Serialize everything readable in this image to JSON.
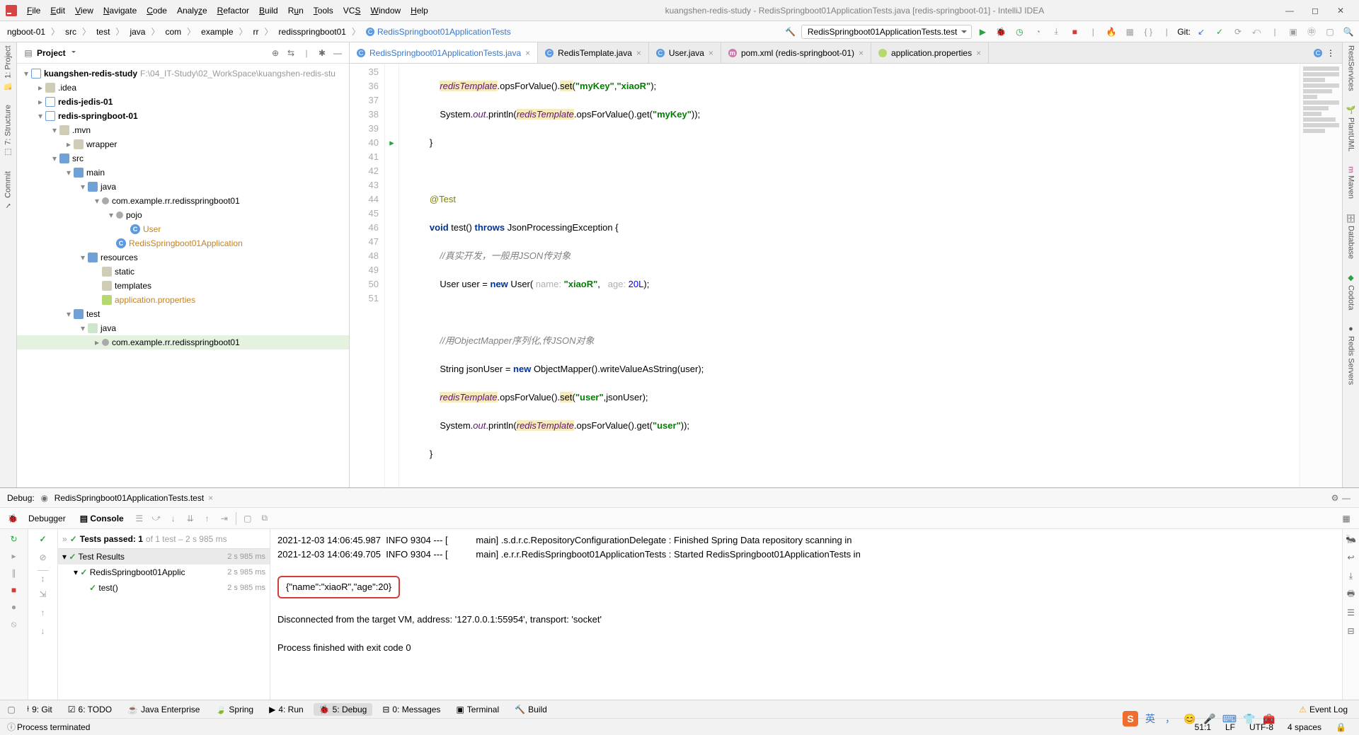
{
  "window_title": "kuangshen-redis-study - RedisSpringboot01ApplicationTests.java [redis-springboot-01] - IntelliJ IDEA",
  "menubar": [
    "File",
    "Edit",
    "View",
    "Navigate",
    "Code",
    "Analyze",
    "Refactor",
    "Build",
    "Run",
    "Tools",
    "VCS",
    "Window",
    "Help"
  ],
  "breadcrumb": [
    "ngboot-01",
    "src",
    "test",
    "java",
    "com",
    "example",
    "rr",
    "redisspringboot01",
    "RedisSpringboot01ApplicationTests"
  ],
  "run_target": "RedisSpringboot01ApplicationTests.test",
  "git_label": "Git:",
  "left_tabs": [
    "1: Project",
    "7: Structure",
    "Commit"
  ],
  "right_tabs": [
    "RestServices",
    "PlantUML",
    "Maven",
    "Database",
    "Codota",
    "Redis Servers"
  ],
  "sidebar": {
    "title": "Project",
    "root": "kuangshen-redis-study",
    "root_path": "F:\\04_IT-Study\\02_WorkSpace\\kuangshen-redis-stu",
    "nodes": [
      ".idea",
      "redis-jedis-01",
      "redis-springboot-01",
      ".mvn",
      "wrapper",
      "src",
      "main",
      "java",
      "com.example.rr.redisspringboot01",
      "pojo",
      "User",
      "RedisSpringboot01Application",
      "resources",
      "static",
      "templates",
      "application.properties",
      "test",
      "java",
      "com.example.rr.redisspringboot01"
    ]
  },
  "tabs": [
    {
      "label": "RedisSpringboot01ApplicationTests.java",
      "icon": "C",
      "active": true
    },
    {
      "label": "RedisTemplate.java",
      "icon": "C"
    },
    {
      "label": "User.java",
      "icon": "C"
    },
    {
      "label": "pom.xml (redis-springboot-01)",
      "icon": "m"
    },
    {
      "label": "application.properties",
      "icon": "p"
    }
  ],
  "code_start_line": 35,
  "code": {
    "l35": {
      "pre": "            ",
      "warn": "redisTemplate",
      "mid": ".opsForValue().",
      "set": "set",
      "s1": "\"myKey\"",
      "s2": "\"xiaoR\"",
      "tail": ");"
    },
    "l36": {
      "pre": "            System.",
      "out": "out",
      "mid": ".println(",
      "warn": "redisTemplate",
      "tail1": ".opsForValue().get(",
      "s": "\"myKey\"",
      "tail2": "));"
    },
    "brace": "        }",
    "ann": "@Test",
    "sig": {
      "v": "void",
      "name": " test() ",
      "th": "throws",
      "ex": " JsonProcessingException {"
    },
    "c1": "//真实开发，一般用JSON传对象",
    "l42": {
      "pre": "            User user = ",
      "new": "new",
      "mid": " User( ",
      "h1": "name: ",
      "s1": "\"xiaoR\"",
      "sep": ",   ",
      "h2": "age: ",
      "n": "20L",
      "tail": ");"
    },
    "c2": "//用ObjectMapper序列化,传JSON对象",
    "l45": {
      "pre": "            String jsonUser = ",
      "new": "new",
      "tail": " ObjectMapper().writeValueAsString(user);"
    },
    "l46": {
      "pre": "            ",
      "warn": "redisTemplate",
      "mid": ".opsForValue().",
      "set": "set",
      "s": "\"user\"",
      "tail": ",jsonUser);"
    },
    "l47": {
      "pre": "            System.",
      "out": "out",
      "mid": ".println(",
      "warn": "redisTemplate",
      "t1": ".opsForValue().get(",
      "s": "\"user\"",
      "t2": "));"
    },
    "brace2": "        }",
    "cbrace": "    }"
  },
  "debug": {
    "label": "Debug:",
    "config": "RedisSpringboot01ApplicationTests.test",
    "tab_debugger": "Debugger",
    "tab_console": "Console",
    "tests_passed": "Tests passed: 1",
    "tests_total": " of 1 test – 2 s 985 ms",
    "test_results": "Test Results",
    "test1": "RedisSpringboot01Applic",
    "test2": "test()",
    "dur": "2 s 985 ms",
    "log1": "2021-12-03 14:06:45.987  INFO 9304 --- [           main] .s.d.r.c.RepositoryConfigurationDelegate : Finished Spring Data repository scanning in ",
    "log2": "2021-12-03 14:06:49.705  INFO 9304 --- [           main] .e.r.r.RedisSpringboot01ApplicationTests : Started RedisSpringboot01ApplicationTests in ",
    "json_out": "{\"name\":\"xiaoR\",\"age\":20}",
    "log3": "Disconnected from the target VM, address: '127.0.0.1:55954', transport: 'socket'",
    "log4": "Process finished with exit code 0"
  },
  "bottom_tabs": [
    "9: Git",
    "6: TODO",
    "Java Enterprise",
    "Spring",
    "4: Run",
    "5: Debug",
    "0: Messages",
    "Terminal",
    "Build"
  ],
  "event_log": "Event Log",
  "status": {
    "msg": "Process terminated",
    "pos": "51:1",
    "le": "LF",
    "enc": "UTF-8",
    "spaces": "4 spaces"
  }
}
